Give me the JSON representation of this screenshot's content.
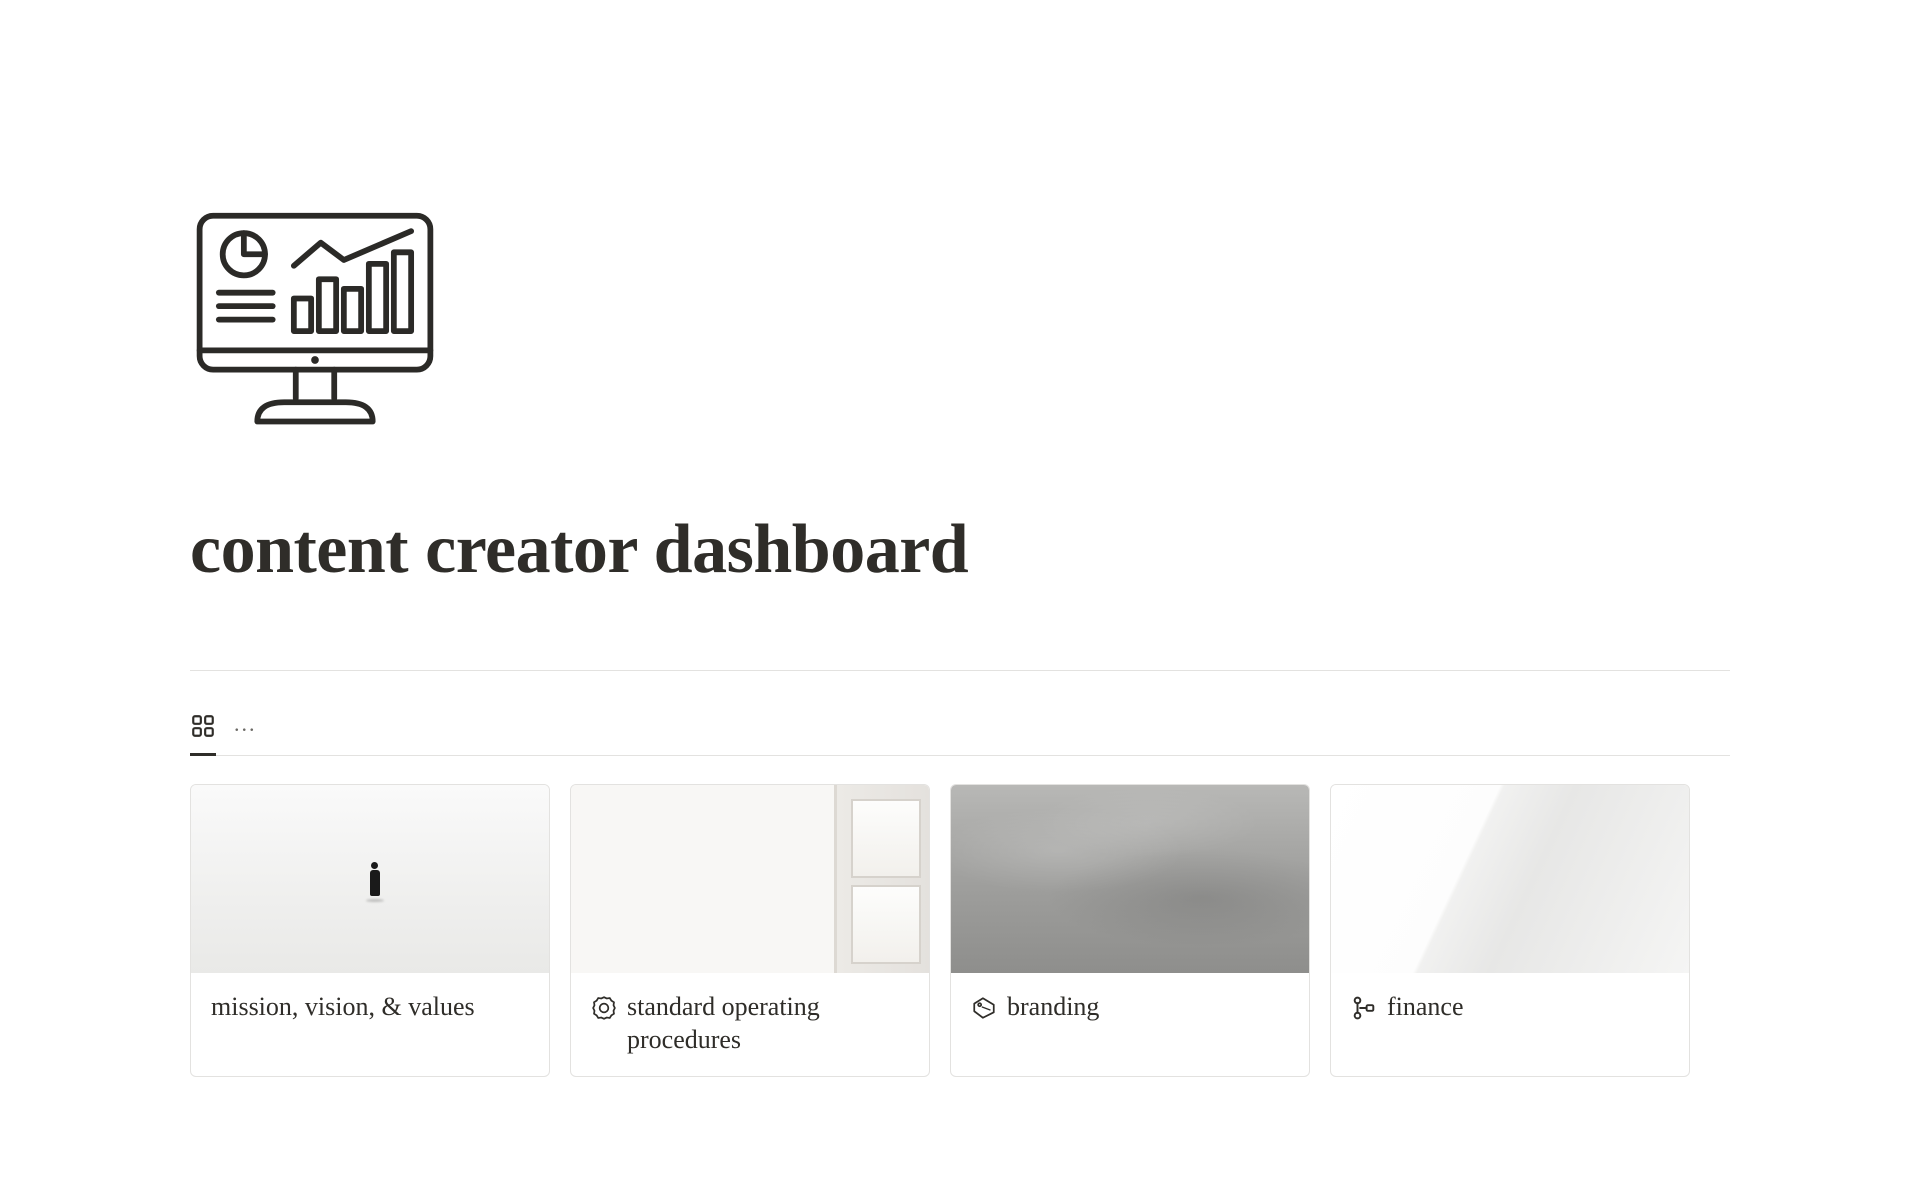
{
  "page": {
    "title": "content creator dashboard"
  },
  "tabs": {
    "more": "..."
  },
  "cards": [
    {
      "title": "mission, vision, & values"
    },
    {
      "title": "standard operating procedures"
    },
    {
      "title": "branding"
    },
    {
      "title": "finance"
    }
  ]
}
